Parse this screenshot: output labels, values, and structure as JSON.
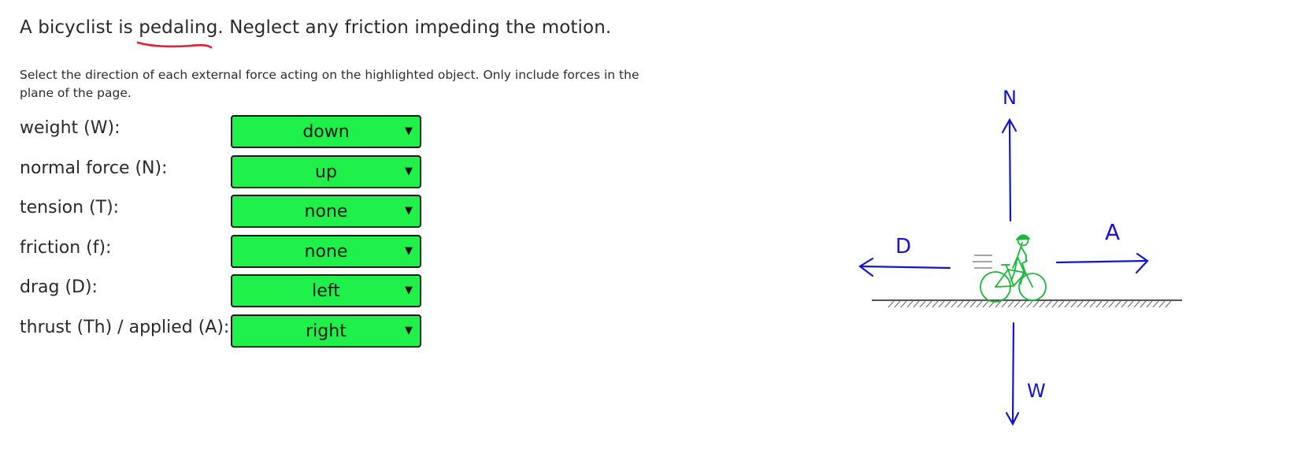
{
  "problem": {
    "before": "A bicyclist is ",
    "highlight": "pedaling",
    "after": ". Neglect any friction impeding the motion."
  },
  "instructions": "Select the direction of each external force acting on the highlighted object. Only include forces in the plane of the page.",
  "forces": [
    {
      "label": "weight (W):",
      "value": "down"
    },
    {
      "label": "normal force (N):",
      "value": "up"
    },
    {
      "label": "tension (T):",
      "value": "none"
    },
    {
      "label": "friction (f):",
      "value": "none"
    },
    {
      "label": "drag (D):",
      "value": "left"
    },
    {
      "label": "thrust (Th) / applied (A):",
      "value": "right"
    }
  ],
  "caret": "▼",
  "diagram": {
    "labels": {
      "N": "N",
      "D": "D",
      "A": "A",
      "W": "W"
    },
    "colors": {
      "arrows": "#1414d2",
      "bicyclist": "#18b838",
      "underline": "#e02030",
      "select_bg": "#1ff04a"
    }
  }
}
